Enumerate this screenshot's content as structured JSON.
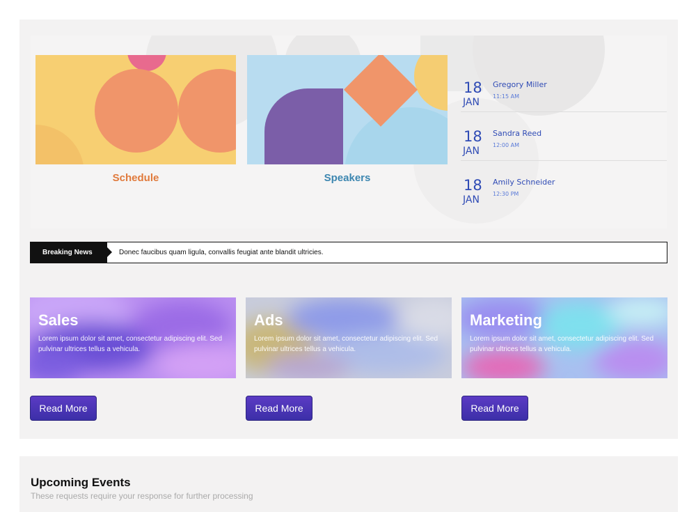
{
  "hero": {
    "cards": [
      {
        "title": "Schedule",
        "title_color": "#e07a3c"
      },
      {
        "title": "Speakers",
        "title_color": "#3c86b0"
      }
    ],
    "events": [
      {
        "day": "18",
        "month": "JAN",
        "name": "Gregory Miller",
        "time": "11:15 AM"
      },
      {
        "day": "18",
        "month": "JAN",
        "name": "Sandra Reed",
        "time": "12:00 AM"
      },
      {
        "day": "18",
        "month": "JAN",
        "name": "Amily Schneider",
        "time": "12:30 PM"
      }
    ]
  },
  "ticker": {
    "label": "Breaking News",
    "text": "Donec faucibus quam ligula, convallis feugiat ante blandit ultricies."
  },
  "promos": [
    {
      "title": "Sales",
      "description": "Lorem ipsum dolor sit amet, consectetur adipiscing elit. Sed pulvinar ultrices tellus a vehicula.",
      "button": "Read More"
    },
    {
      "title": "Ads",
      "description": "Lorem ipsum dolor sit amet, consectetur adipiscing elit. Sed pulvinar ultrices tellus a vehicula.",
      "button": "Read More"
    },
    {
      "title": "Marketing",
      "description": "Lorem ipsum dolor sit amet, consectetur adipiscing elit. Sed pulvinar ultrices tellus a vehicula.",
      "button": "Read More"
    }
  ],
  "upcoming": {
    "title": "Upcoming Events",
    "subtitle": "These requests require your response for further processing"
  },
  "colors": {
    "accent": "#4a34b8",
    "event_text": "#2f4bb5"
  }
}
